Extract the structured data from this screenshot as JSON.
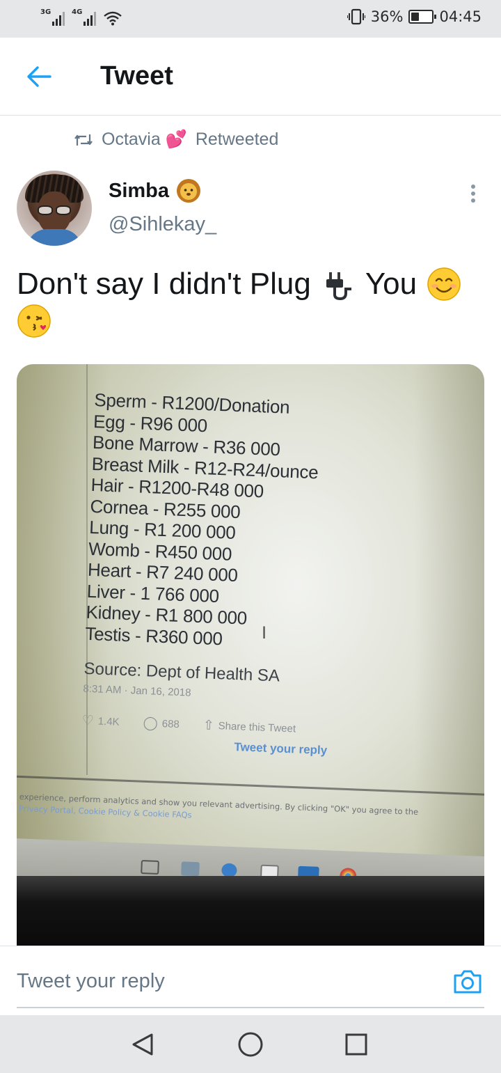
{
  "status_bar": {
    "network1": "3G",
    "network2": "4G",
    "battery_percent": "36%",
    "time": "04:45",
    "battery_level": 0.36
  },
  "header": {
    "title": "Tweet",
    "back_icon": "back-arrow-icon"
  },
  "retweet": {
    "icon": "retweet-icon",
    "by": "Octavia 💕",
    "label": "Retweeted"
  },
  "tweet": {
    "author_name": "Simba",
    "author_emoji": "lion-face-emoji",
    "handle": "@Sihlekay_",
    "text_part1": "Don't say I didn't Plug",
    "text_part2": "You",
    "emojis": [
      "electric-plug-emoji",
      "smiling-face-emoji",
      "kissing-face-emoji"
    ]
  },
  "photo": {
    "price_list": [
      "Sperm - R1200/Donation",
      "Egg - R96 000",
      "Bone Marrow - R36 000",
      "Breast Milk - R12-R24/ounce",
      "Hair - R1200-R48 000",
      "Cornea - R255 000",
      "Lung - R1 200 000",
      "Womb - R450 000",
      "Heart - R7 240 000",
      "Liver - 1 766 000",
      "Kidney - R1 800 000",
      "Testis - R360 000"
    ],
    "source": "Source: Dept of Health SA",
    "time": "8:31 AM · Jan 16, 2018",
    "likes": "1.4K",
    "replies": "688",
    "share": "Share this Tweet",
    "reply_prompt": "Tweet your reply",
    "cookie_line1": "experience, perform analytics and show you relevant advertising. By clicking \"OK\" you agree to the",
    "cookie_line2": "Privacy Portal, Cookie Policy & Cookie FAQs"
  },
  "reply_bar": {
    "placeholder": "Tweet your reply",
    "camera_icon": "camera-icon"
  },
  "nav": {
    "back": "nav-back-icon",
    "home": "nav-home-icon",
    "recents": "nav-recents-icon"
  },
  "colors": {
    "accent": "#1da1f2",
    "secondary_text": "#657786",
    "status_bar_bg": "#e6e7e9"
  }
}
